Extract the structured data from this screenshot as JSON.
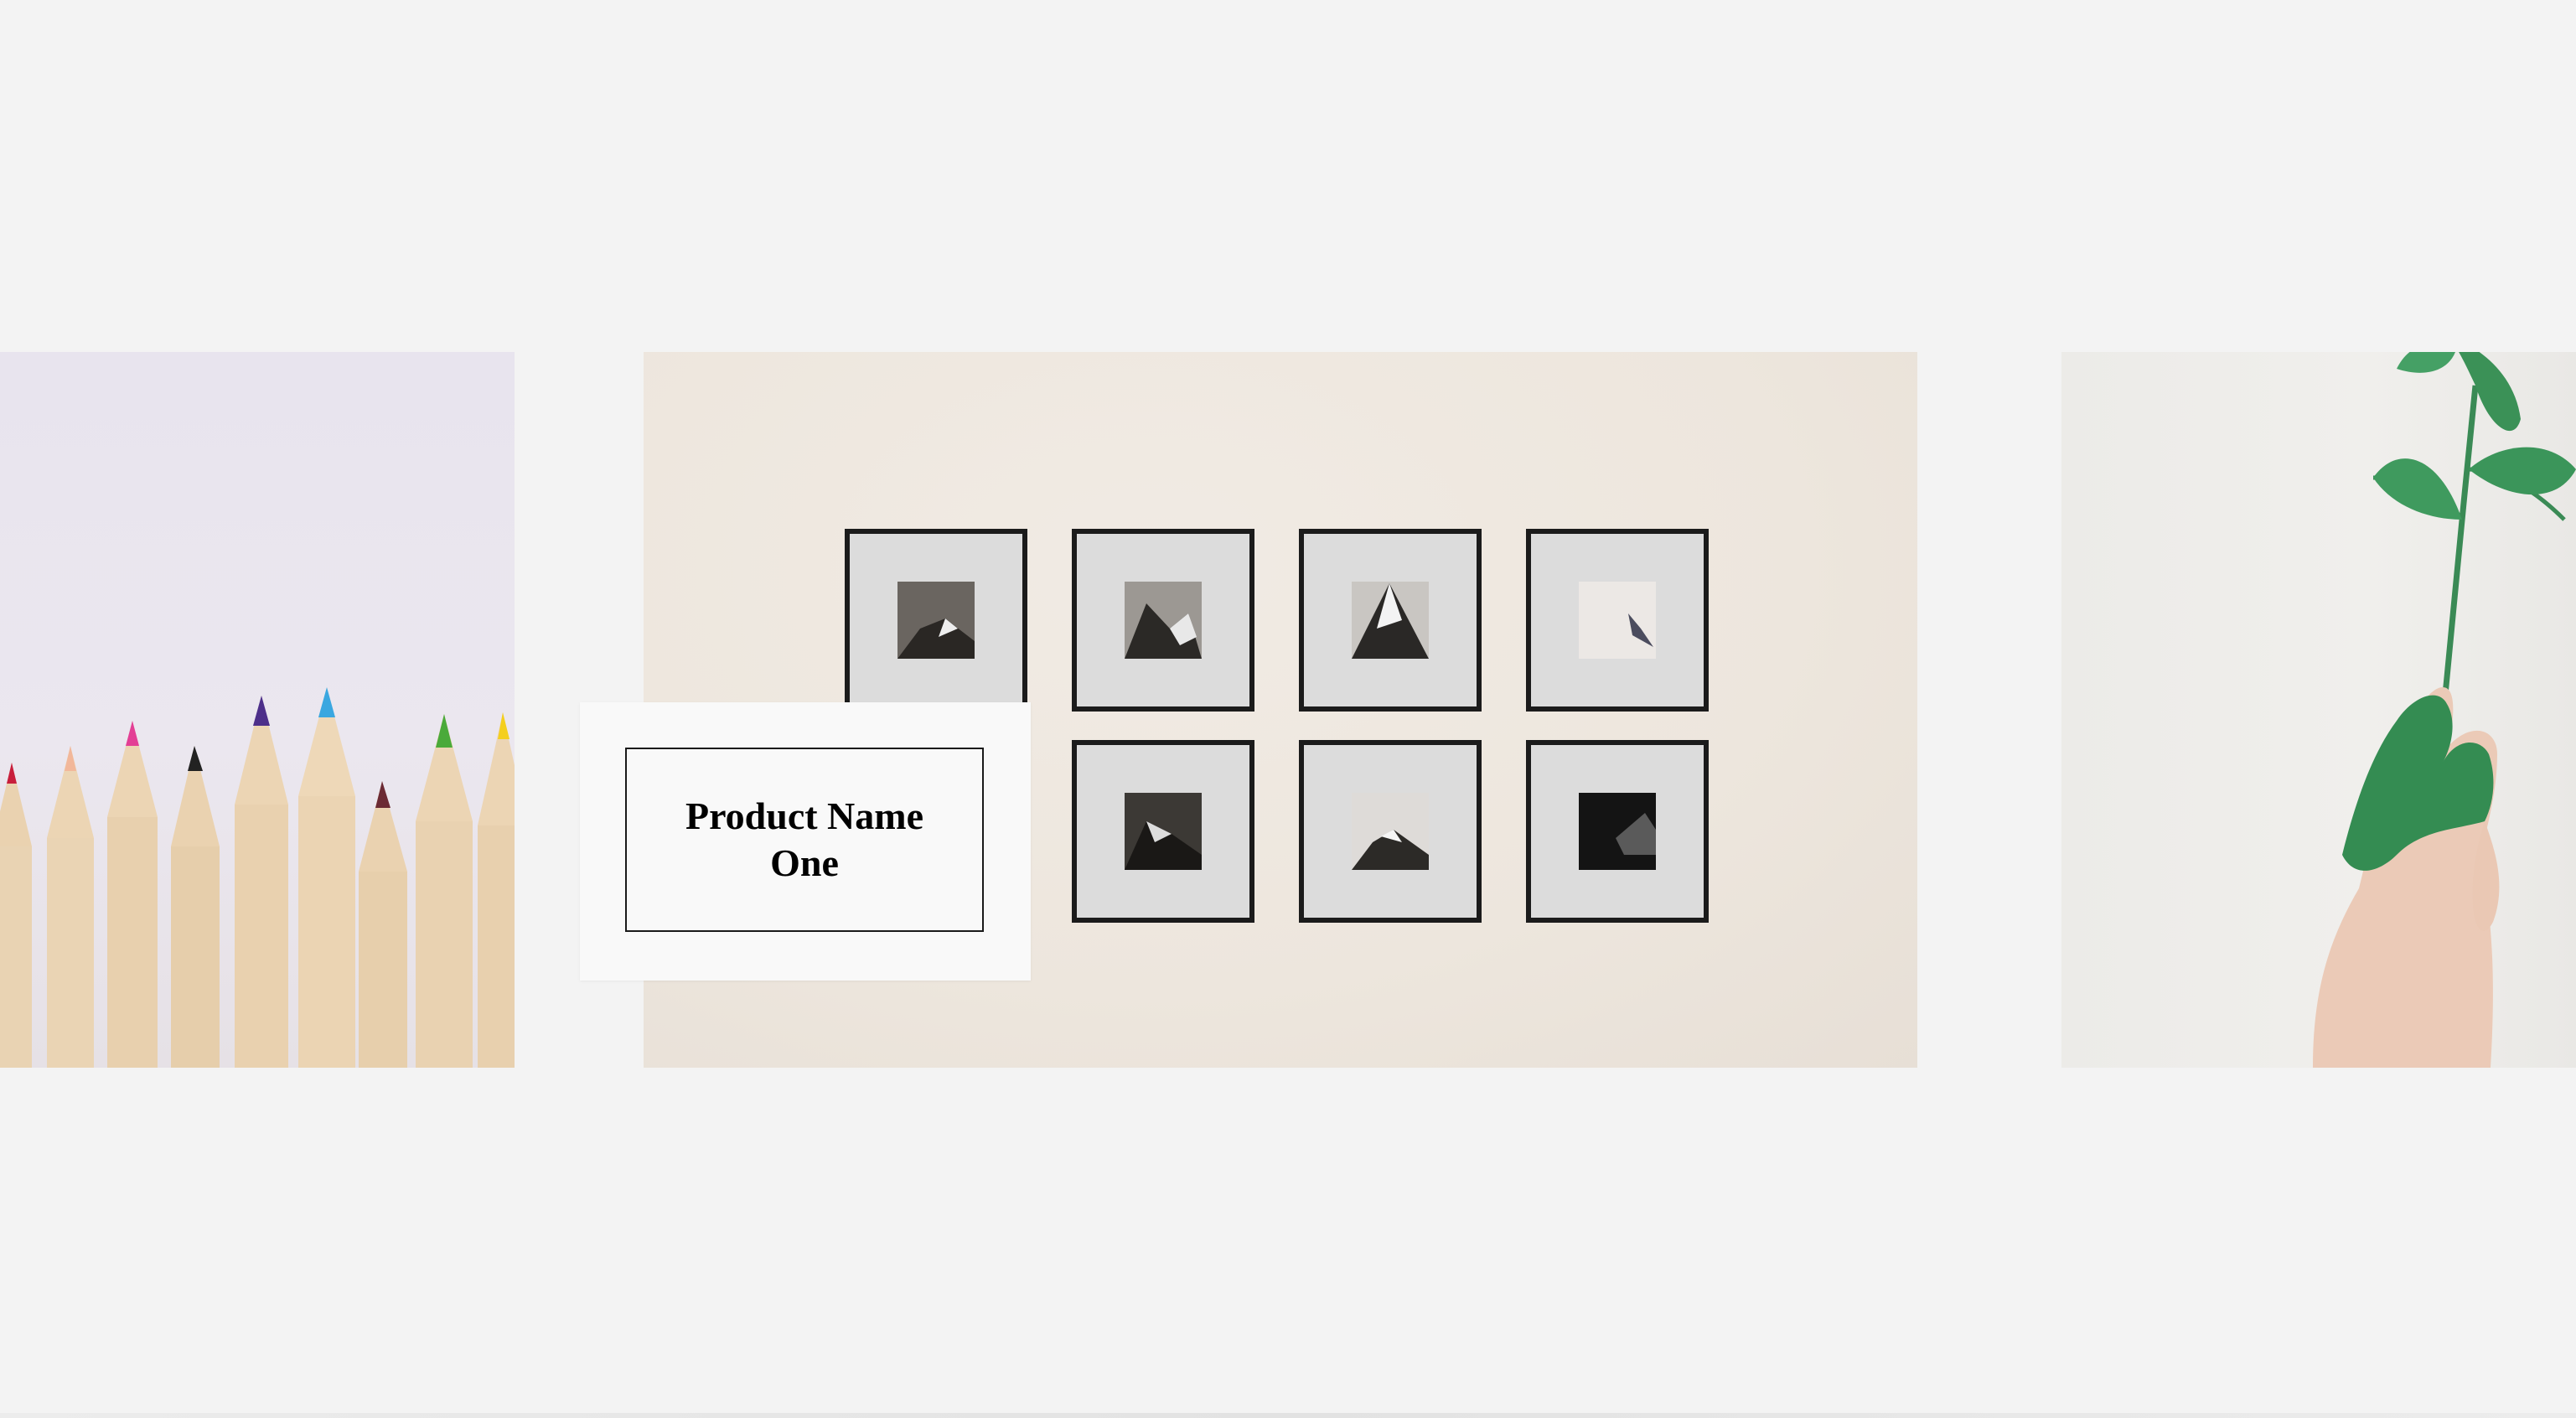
{
  "product": {
    "name": "Product Name One"
  },
  "slides": [
    {
      "icon": "colored-pencils-photo"
    },
    {
      "icon": "framed-mountain-prints-photo"
    },
    {
      "icon": "green-painted-hand-plant-photo"
    }
  ],
  "colors": {
    "page_background": "#f3f3f3",
    "card_background": "#f9f9f9",
    "frame_border": "#1a1a1a",
    "leaf_green": "#3a8a55"
  }
}
